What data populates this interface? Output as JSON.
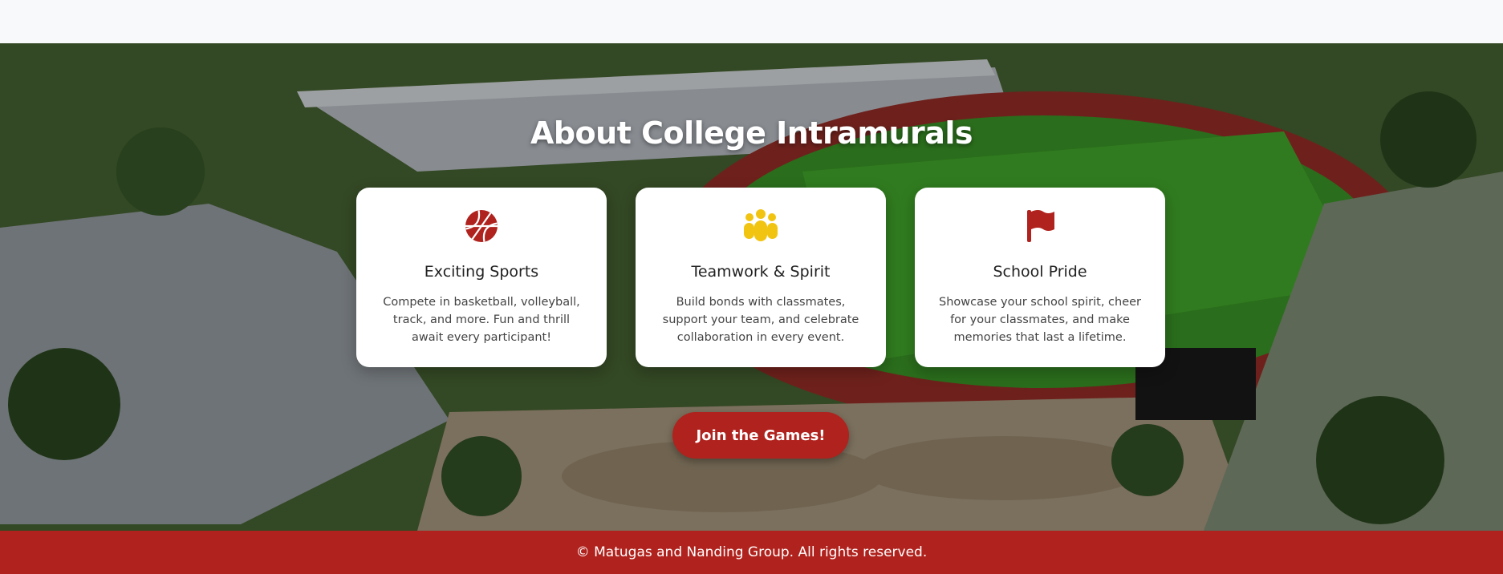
{
  "hero": {
    "title": "About College Intramurals",
    "cards": [
      {
        "icon": "basketball-icon",
        "icon_color": "#b0221d",
        "title": "Exciting Sports",
        "text": "Compete in basketball, volleyball, track, and more. Fun and thrill await every participant!"
      },
      {
        "icon": "people-group-icon",
        "icon_color": "#f2c412",
        "title": "Teamwork & Spirit",
        "text": "Build bonds with classmates, support your team, and celebrate collaboration in every event."
      },
      {
        "icon": "flag-icon",
        "icon_color": "#b0221d",
        "title": "School Pride",
        "text": "Showcase your school spirit, cheer for your classmates, and make memories that last a lifetime."
      }
    ],
    "cta_label": "Join the Games!"
  },
  "footer": {
    "text": "© Matugas and Nanding Group. All rights reserved."
  },
  "colors": {
    "accent": "#b0221d",
    "yellow": "#f2c412",
    "card_bg": "#ffffff"
  }
}
